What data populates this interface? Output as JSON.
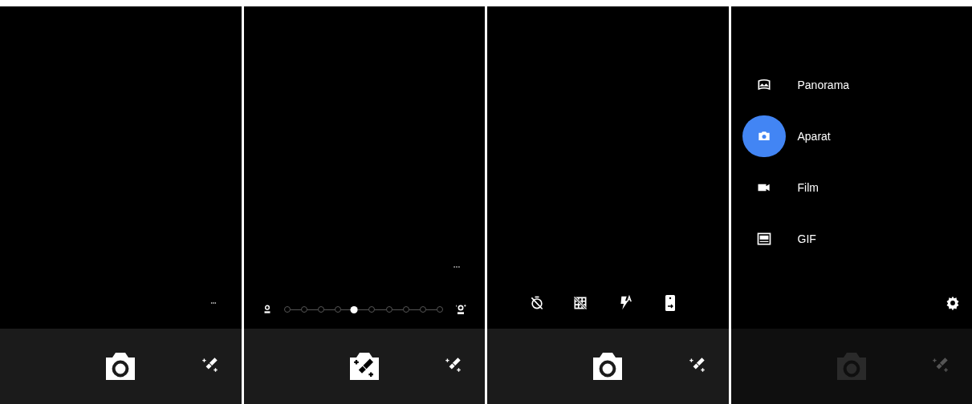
{
  "panels": [
    {
      "kind": "more",
      "dimmed": false,
      "shutter": {
        "kind": "photo"
      }
    },
    {
      "kind": "slider",
      "dimmed": false,
      "shutter": {
        "kind": "beauty"
      },
      "level": 0.44
    },
    {
      "kind": "toggles",
      "dimmed": false,
      "shutter": {
        "kind": "photo"
      }
    },
    {
      "kind": "menu",
      "dimmed": true,
      "shutter": {
        "kind": "photo"
      },
      "menu": [
        {
          "label": "Panorama",
          "selected": false
        },
        {
          "label": "Aparat",
          "selected": true
        },
        {
          "label": "Film",
          "selected": false
        },
        {
          "label": "GIF",
          "selected": false
        }
      ]
    }
  ]
}
